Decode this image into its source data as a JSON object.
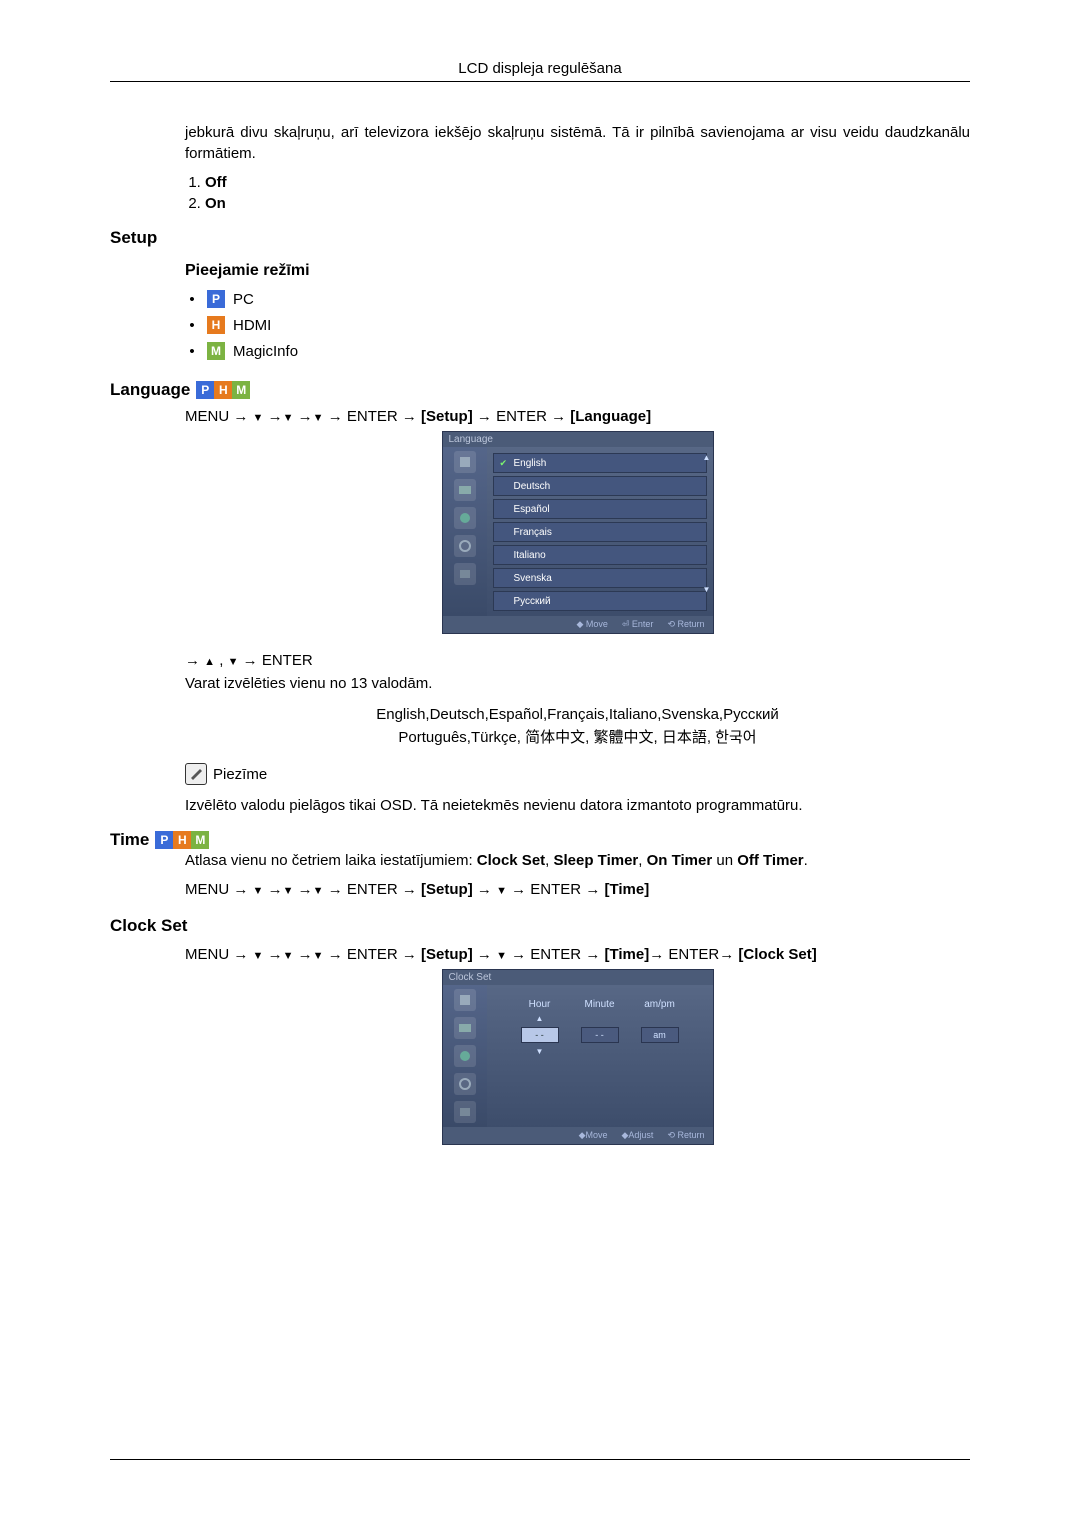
{
  "header": {
    "title": "LCD displeja regulēšana"
  },
  "intro_para": "jebkurā divu skaļruņu, arī televizora iekšējo skaļruņu sistēmā. Tā ir pilnībā savienojama ar visu veidu daudzkanālu formātiem.",
  "options": {
    "off": "Off",
    "on": "On"
  },
  "setup": {
    "title": "Setup"
  },
  "modes": {
    "title": "Pieejamie režīmi",
    "pc": "PC",
    "hdmi": "HDMI",
    "magicinfo": "MagicInfo"
  },
  "language": {
    "title": "Language",
    "nav1_prefix": "MENU → ",
    "arrow_down": "▼",
    "arrow_right": " → ",
    "enter": "ENTER",
    "arr_sep": " →",
    "setup_label": "[Setup]",
    "language_label": "[Language]",
    "nav2_prefix": "→ ",
    "arrow_up": "▲",
    "comma": " , ",
    "choose_text": "Varat izvēlēties vienu no 13 valodām.",
    "lang_list_1": "English,Deutsch,Español,Français,Italiano,Svenska,Русский",
    "lang_list_2": "Português,Türkçe, 简体中文,  繁體中文, 日本語, 한국어",
    "note_label": "Piezīme",
    "note_text": "Izvēlēto valodu pielāgos tikai OSD. Tā neietekmēs nevienu datora izmantoto programmatūru."
  },
  "osd": {
    "title": "Language",
    "items": [
      "English",
      "Deutsch",
      "Español",
      "Français",
      "Italiano",
      "Svenska",
      "Русский"
    ],
    "footer_move": "◆ Move",
    "footer_enter": "⏎ Enter",
    "footer_return": "⟲ Return"
  },
  "time": {
    "title": "Time",
    "intro_a": "Atlasa vienu no četriem laika iestatījumiem: ",
    "cs": "Clock Set",
    "st": "Sleep Timer",
    "ont": "On Timer",
    "un": " un ",
    "oft": "Off Timer",
    "period": ".",
    "sep": ", ",
    "nav_prefix": "MENU → ",
    "time_label": "[Time]"
  },
  "clockset": {
    "title": "Clock Set",
    "cs_label": "[Clock Set]"
  },
  "clock_osd": {
    "title": "Clock Set",
    "hour": "Hour",
    "minute": "Minute",
    "ampm": "am/pm",
    "dash": "- -",
    "am": "am",
    "footer_move": "◆Move",
    "footer_adjust": "◆Adjust",
    "footer_return": "⟲ Return"
  }
}
